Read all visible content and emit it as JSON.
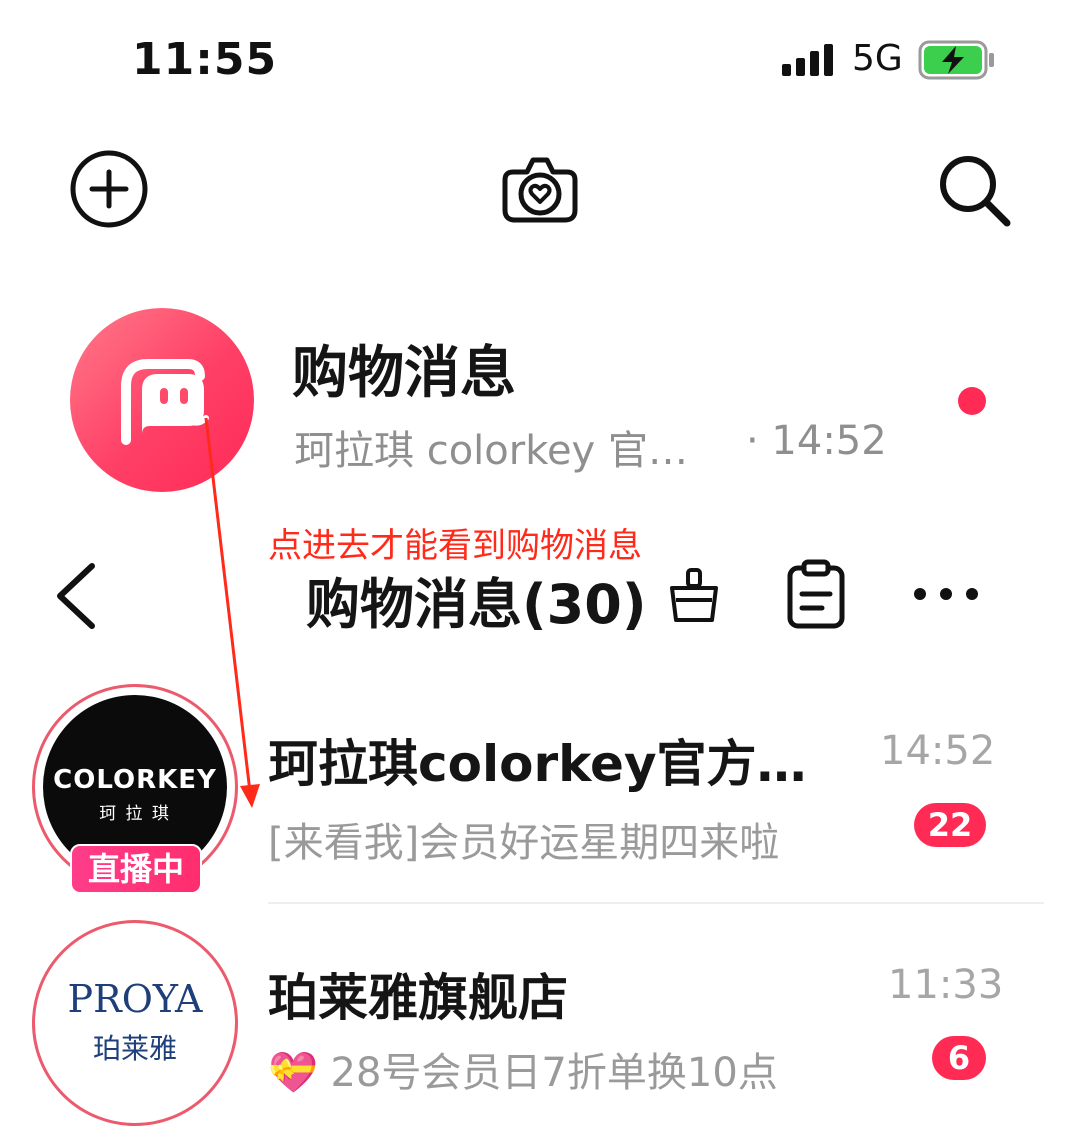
{
  "status_bar": {
    "time": "11:55",
    "network": "5G"
  },
  "top_bar": {
    "icons": [
      "add-icon",
      "camera-heart-icon",
      "search-icon"
    ]
  },
  "shopping_entry": {
    "title": "购物消息",
    "subtitle": "珂拉琪 colorkey 官…",
    "time": "· 14:52",
    "unread_dot_color": "#ff2b55"
  },
  "annotation": {
    "text": "点进去才能看到购物消息",
    "color": "#ff2a1a"
  },
  "list_header": {
    "title": "购物消息(30)",
    "icons": [
      "back-icon",
      "broom-icon",
      "clipboard-icon",
      "more-icon"
    ]
  },
  "conversations": [
    {
      "logo_main": "COLORKEY",
      "logo_sub": "珂 拉 琪",
      "live_tag": "直播中",
      "name": "珂拉琪colorkey官方…",
      "time": "14:52",
      "preview": "[来看我]会员好运星期四来啦",
      "unread": "22"
    },
    {
      "logo_main": "PROYA",
      "logo_sub": "珀莱雅",
      "name": "珀莱雅旗舰店",
      "time": "11:33",
      "preview": "💝 28号会员日7折单换10点",
      "unread": "6"
    }
  ],
  "colors": {
    "accent": "#ff2b55",
    "brand_gradient_start": "#ff7a8a",
    "brand_gradient_end": "#ff2a58"
  }
}
